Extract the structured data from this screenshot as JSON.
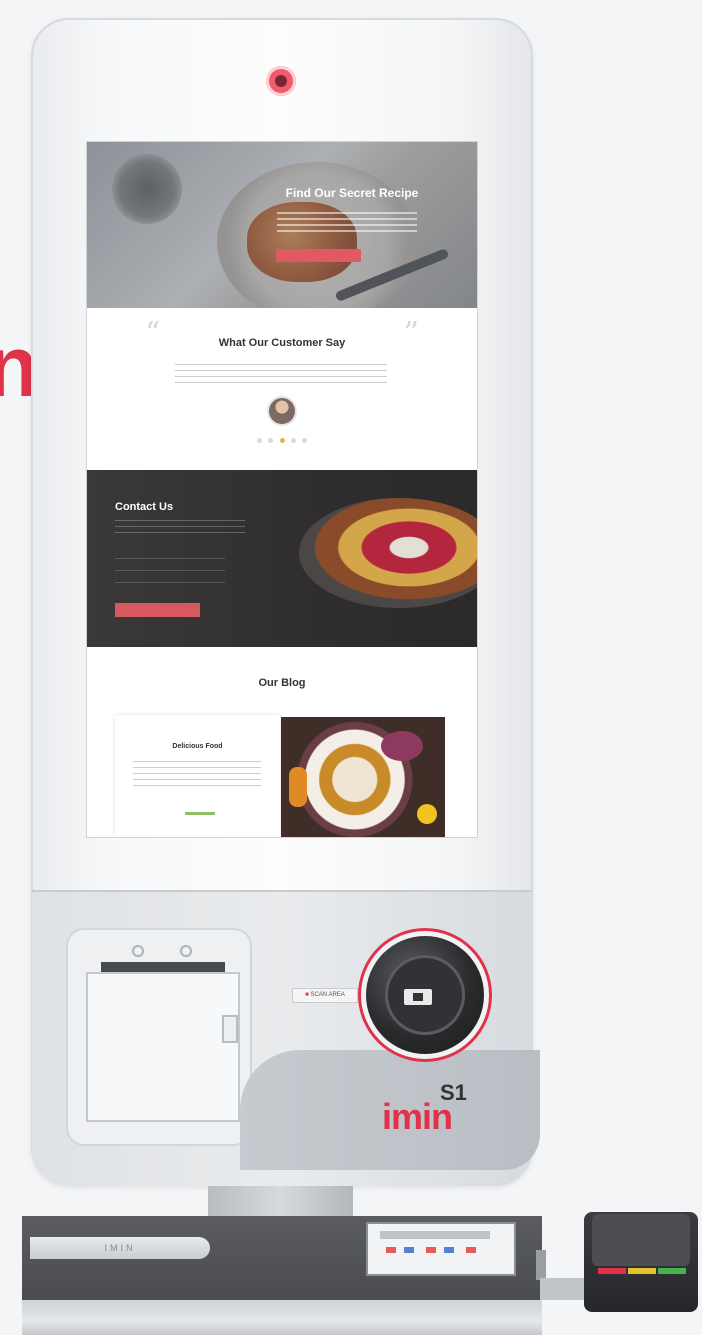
{
  "brand_fragment": "n",
  "screen": {
    "hero": {
      "title": "Find Our Secret Recipe"
    },
    "testimonials": {
      "title": "What Our Customer Say",
      "quote_left": "“",
      "quote_right": "”",
      "dots": 5,
      "active_dot": 2
    },
    "contact": {
      "title": "Contact Us"
    },
    "blog": {
      "title": "Our Blog",
      "card_title": "Delicious Food"
    }
  },
  "device": {
    "scan_label_prefix": "■",
    "scan_label": "SCAN AREA",
    "model": "S1",
    "logo": "imin",
    "base_strip_text": "IMIN"
  },
  "colors": {
    "brand": "#e0334a",
    "accent_button": "#e05a63"
  },
  "icons": [
    "camera-icon",
    "card-icon",
    "scanner-icon"
  ]
}
